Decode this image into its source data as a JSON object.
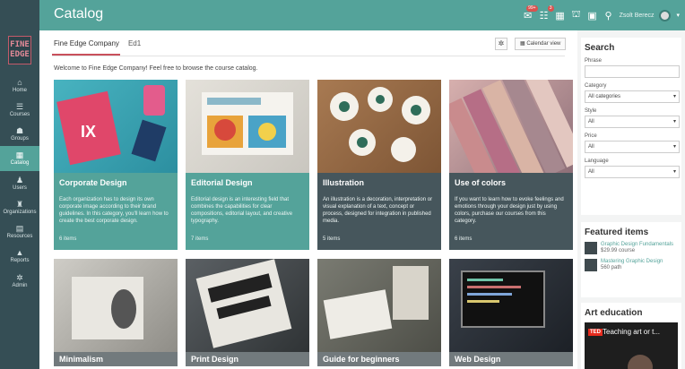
{
  "app": {
    "page_title": "Catalog"
  },
  "logo": {
    "line1": "FINE",
    "line2": "EDGE"
  },
  "sidebar": {
    "items": [
      {
        "label": "Home",
        "icon": "home-icon",
        "glyph": "⌂"
      },
      {
        "label": "Courses",
        "icon": "courses-icon",
        "glyph": "☰"
      },
      {
        "label": "Groups",
        "icon": "groups-icon",
        "glyph": "☗"
      },
      {
        "label": "Catalog",
        "icon": "catalog-icon",
        "glyph": "▦"
      },
      {
        "label": "Users",
        "icon": "user-icon",
        "glyph": "♟"
      },
      {
        "label": "Organizations",
        "icon": "organization-icon",
        "glyph": "♜"
      },
      {
        "label": "Resources",
        "icon": "resources-icon",
        "glyph": "▤"
      },
      {
        "label": "Reports",
        "icon": "reports-icon",
        "glyph": "▲"
      },
      {
        "label": "Admin",
        "icon": "gear-icon",
        "glyph": "✲"
      }
    ]
  },
  "topbar": {
    "user_name": "Zsolt Berecz",
    "badges": {
      "notifications": "99+",
      "messages": "3"
    }
  },
  "tabs": [
    {
      "label": "Fine Edge Company"
    },
    {
      "label": "Ed1"
    }
  ],
  "toolbar": {
    "calendar_label": "Calendar view"
  },
  "welcome": "Welcome to Fine Edge Company! Feel free to browse the course catalog.",
  "cards": [
    {
      "title": "Corporate Design",
      "desc": "Each organization has to design its own corporate image according to their brand guidelines. In this category, you'll learn how to create the best corporate design.",
      "count": "6 items",
      "thumb_color": "#3aa8b7"
    },
    {
      "title": "Editorial Design",
      "desc": "Editorial design is an interesting field that combines the capabilities for clear compositions, editorial layout, and creative typography.",
      "count": "7 items",
      "thumb_color": "#d9d6cf"
    },
    {
      "title": "Illustration",
      "desc": "An illustration is a decoration, interpretation or visual explanation of a text, concept or process, designed for integration in published media.",
      "count": "5 items",
      "thumb_color": "#9a6b45"
    },
    {
      "title": "Use of colors",
      "desc": "If you want to learn how to evoke feelings and emotions through your design just by using colors, purchase our courses from this category.",
      "count": "6 items",
      "thumb_color": "#c9a2a0"
    },
    {
      "title": "Minimalism",
      "thumb_color": "#b9b7b1"
    },
    {
      "title": "Print Design",
      "thumb_color": "#4a4f52"
    },
    {
      "title": "Guide for beginners",
      "thumb_color": "#6e6f66"
    },
    {
      "title": "Web Design",
      "thumb_color": "#2b3138"
    }
  ],
  "search": {
    "title": "Search",
    "phrase_label": "Phrase",
    "category_label": "Category",
    "category_value": "All categories",
    "style_label": "Style",
    "style_value": "All",
    "price_label": "Price",
    "price_value": "All",
    "language_label": "Language",
    "language_value": "All"
  },
  "featured": {
    "title": "Featured items",
    "items": [
      {
        "name": "Graphic Design Fundamentals",
        "price": "$29.99 course"
      },
      {
        "name": "Mastering Graphic Design",
        "price": "560 path"
      }
    ]
  },
  "art": {
    "title": "Art education",
    "video_title": "Teaching art or t...",
    "video_brand": "TED"
  }
}
